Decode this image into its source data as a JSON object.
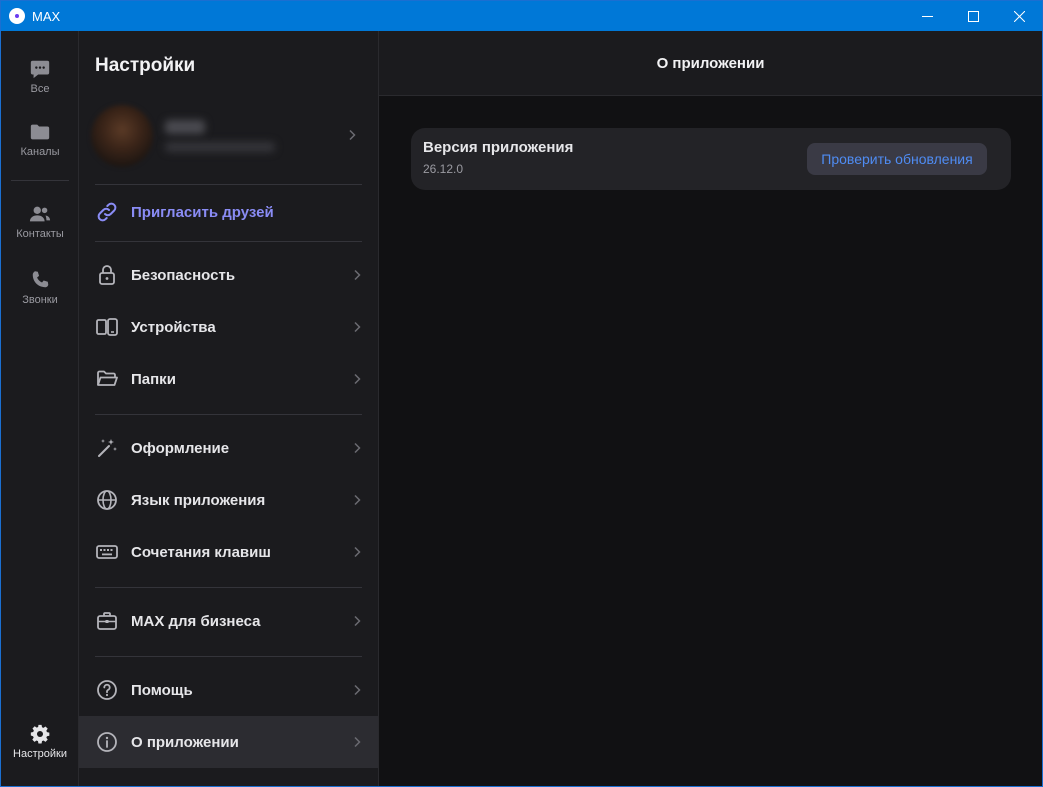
{
  "window": {
    "title": "MAX"
  },
  "rail": {
    "items": [
      {
        "label": "Все",
        "icon": "chat-icon"
      },
      {
        "label": "Каналы",
        "icon": "folder-icon"
      },
      {
        "label": "Контакты",
        "icon": "contacts-icon"
      },
      {
        "label": "Звонки",
        "icon": "phone-icon"
      },
      {
        "label": "Настройки",
        "icon": "gear-icon",
        "active": true
      }
    ]
  },
  "settings": {
    "title": "Настройки",
    "invite": {
      "label": "Пригласить друзей",
      "icon": "link-icon",
      "color": "#8a8cf5"
    },
    "items": [
      {
        "label": "Безопасность",
        "icon": "lock-icon"
      },
      {
        "label": "Устройства",
        "icon": "devices-icon"
      },
      {
        "label": "Папки",
        "icon": "folder-open-icon"
      },
      {
        "label": "Оформление",
        "icon": "magic-wand-icon"
      },
      {
        "label": "Язык приложения",
        "icon": "globe-icon"
      },
      {
        "label": "Сочетания клавиш",
        "icon": "keyboard-icon"
      },
      {
        "label": "MAX для бизнеса",
        "icon": "briefcase-icon"
      },
      {
        "label": "Помощь",
        "icon": "help-icon"
      },
      {
        "label": "О приложении",
        "icon": "info-icon",
        "active": true
      }
    ]
  },
  "main": {
    "title": "О приложении",
    "version_card": {
      "title": "Версия приложения",
      "version": "26.12.0",
      "button_label": "Проверить обновления"
    }
  },
  "colors": {
    "accent": "#4f8cf3",
    "invite": "#8a8cf5",
    "titlebar": "#0078d7"
  }
}
